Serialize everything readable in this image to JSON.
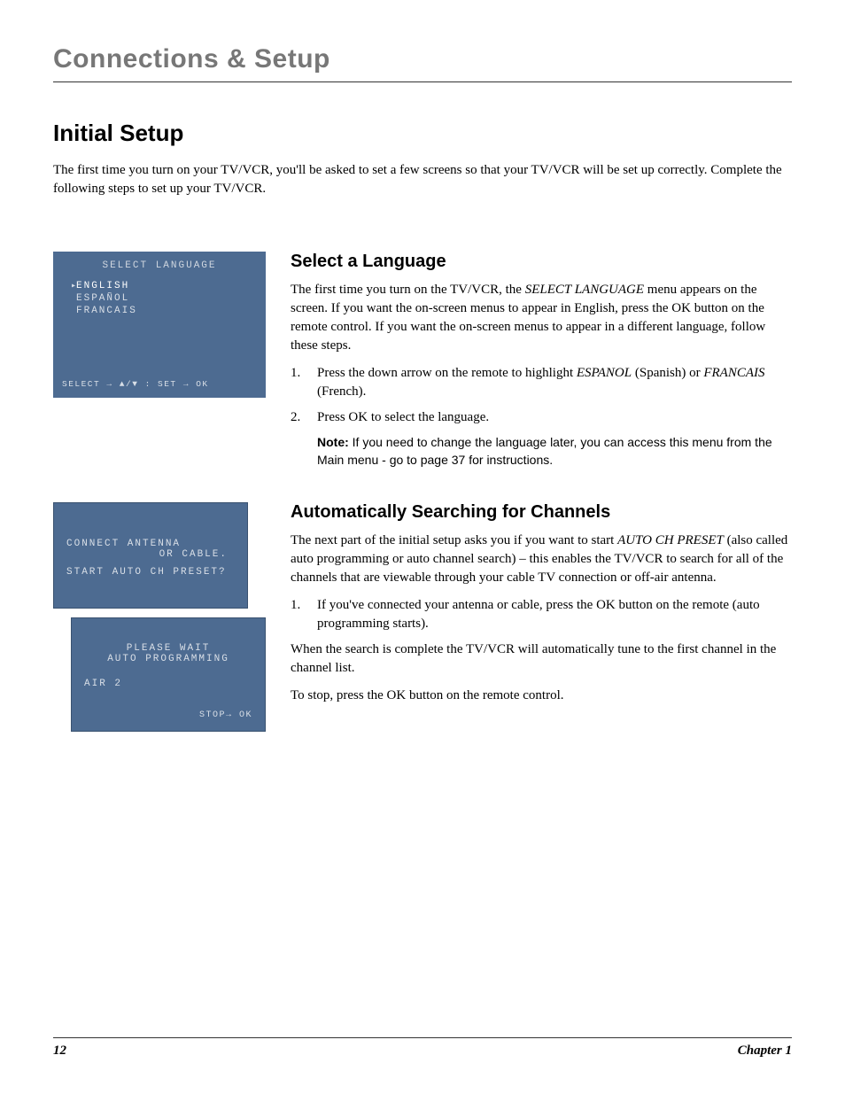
{
  "header": {
    "chapter_title": "Connections & Setup"
  },
  "title": "Initial Setup",
  "intro": "The first time you turn on your TV/VCR, you'll be asked to set a few screens so that your TV/VCR will be set up correctly. Complete the following steps to set up your TV/VCR.",
  "osd_lang": {
    "title": "SELECT LANGUAGE",
    "items": [
      "ENGLISH",
      "ESPAÑOL",
      "FRANCAIS"
    ],
    "footer": "SELECT  →  ▲/▼  : SET  →  OK"
  },
  "osd_antenna": {
    "line1": "CONNECT ANTENNA",
    "line2": "OR CABLE.",
    "line3": "START AUTO CH PRESET?"
  },
  "osd_auto": {
    "line1": "PLEASE WAIT",
    "line2": "AUTO PROGRAMMING",
    "line3": "AIR 2",
    "line4": "STOP→ OK"
  },
  "section1": {
    "heading": "Select a Language",
    "p1a": "The first time you turn on the TV/VCR, the ",
    "p1b": "SELECT LANGUAGE",
    "p1c": " menu appears on the screen. If you want the on-screen menus to appear in English, press the OK button on the remote control.  If you want the on-screen menus to appear in a different language, follow these steps.",
    "step1a": "Press the down arrow on the remote to highlight ",
    "step1b": "ESPANOL",
    "step1c": " (Spanish) or ",
    "step1d": "FRANCAIS",
    "step1e": " (French).",
    "step2": "Press OK to select the language.",
    "note_label": "Note:",
    "note_text": " If you need to change the language later, you can access this menu from the Main menu - go to page 37 for instructions."
  },
  "section2": {
    "heading": "Automatically Searching for Channels",
    "p1a": "The next part of the initial setup asks you if you want to start ",
    "p1b": "AUTO CH PRESET",
    "p1c": " (also called auto programming or auto channel search) – this enables the TV/VCR to search for all of the channels that are viewable through your cable TV connection or off-air antenna.",
    "step1": "If you've connected your antenna or cable, press the OK button on the remote (auto programming starts).",
    "p2": "When the search is complete the TV/VCR will automatically tune to the first channel in the channel list.",
    "p3": "To stop, press the OK button on the remote control."
  },
  "footer": {
    "page": "12",
    "chapter": "Chapter 1"
  }
}
